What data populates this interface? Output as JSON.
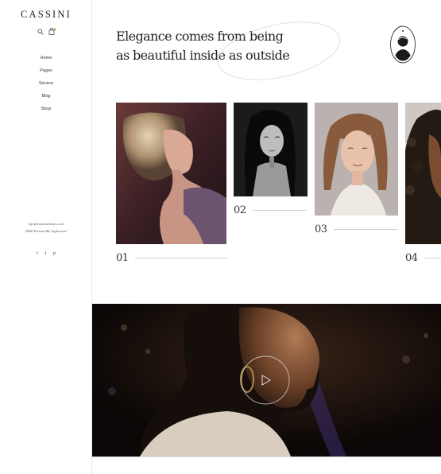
{
  "brand": {
    "logo": "CASSINI"
  },
  "sidebar": {
    "nav": [
      {
        "label": "Home"
      },
      {
        "label": "Pages"
      },
      {
        "label": "Service"
      },
      {
        "label": "Blog"
      },
      {
        "label": "Shop"
      }
    ],
    "contact": {
      "email": "info@cassinithemes.com",
      "address": "8000 Preston Rd, Inglewood"
    },
    "social": [
      {
        "label": "f",
        "icon": "facebook-icon"
      },
      {
        "label": "t",
        "icon": "twitter-icon"
      },
      {
        "label": "p",
        "icon": "pinterest-icon"
      }
    ],
    "cart_count": ""
  },
  "hero": {
    "line1": "Elegance comes from being",
    "line2": "as beautiful inside as outside"
  },
  "gallery": {
    "items": [
      {
        "number": "01"
      },
      {
        "number": "02"
      },
      {
        "number": "03"
      },
      {
        "number": "04"
      }
    ]
  },
  "video": {
    "play_icon": "play-icon"
  },
  "colors": {
    "accent": "#c9a86a",
    "text": "#222222",
    "rule": "#cfcfcf"
  }
}
